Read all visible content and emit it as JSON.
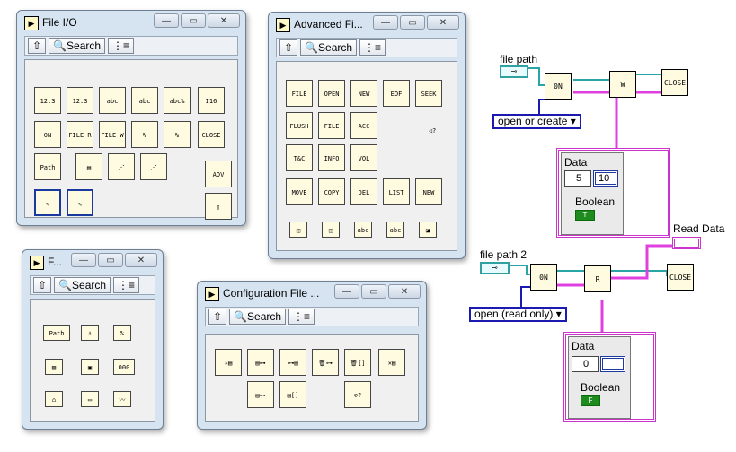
{
  "palettes": {
    "file_io": {
      "title": "File I/O",
      "search": "Search"
    },
    "advanced": {
      "title": "Advanced Fi...",
      "search": "Search"
    },
    "small": {
      "title": "F...",
      "search": "Search"
    },
    "config": {
      "title": "Configuration File ...",
      "search": "Search"
    }
  },
  "window_buttons": {
    "minimize": "—",
    "restore": "▭",
    "close": "✕"
  },
  "diagram": {
    "top": {
      "path_label": "file path",
      "operation": "open or create",
      "cluster_label": "Data",
      "num1": "5",
      "num2": "10",
      "bool_label": "Boolean",
      "bool_val": "T"
    },
    "bottom": {
      "path_label": "file path 2",
      "operation": "open (read only)",
      "indicator_label": "Read Data",
      "cluster_label": "Data",
      "num1": "0",
      "num2": "",
      "bool_label": "Boolean",
      "bool_val": "F"
    },
    "close_text": "CLOSE"
  },
  "colors": {
    "path_wire": "#2aa5a5",
    "refnum_wire": "#2aa5a5",
    "data_wire": "#e040e0",
    "enum_wire": "#1a1ab0"
  }
}
